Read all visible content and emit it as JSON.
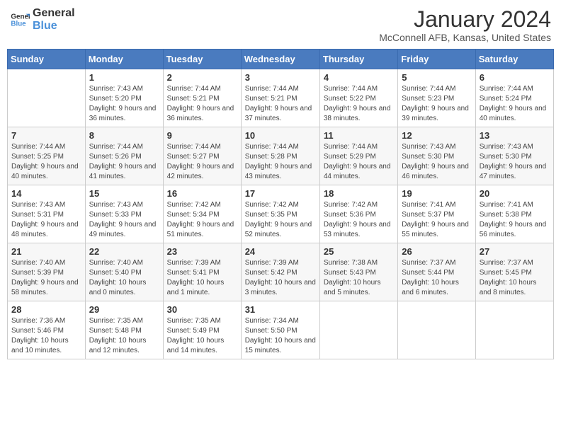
{
  "header": {
    "logo_general": "General",
    "logo_blue": "Blue",
    "month_title": "January 2024",
    "location": "McConnell AFB, Kansas, United States"
  },
  "days_of_week": [
    "Sunday",
    "Monday",
    "Tuesday",
    "Wednesday",
    "Thursday",
    "Friday",
    "Saturday"
  ],
  "weeks": [
    [
      {
        "day": "",
        "info": ""
      },
      {
        "day": "1",
        "info": "Sunrise: 7:43 AM\nSunset: 5:20 PM\nDaylight: 9 hours and 36 minutes."
      },
      {
        "day": "2",
        "info": "Sunrise: 7:44 AM\nSunset: 5:21 PM\nDaylight: 9 hours and 36 minutes."
      },
      {
        "day": "3",
        "info": "Sunrise: 7:44 AM\nSunset: 5:21 PM\nDaylight: 9 hours and 37 minutes."
      },
      {
        "day": "4",
        "info": "Sunrise: 7:44 AM\nSunset: 5:22 PM\nDaylight: 9 hours and 38 minutes."
      },
      {
        "day": "5",
        "info": "Sunrise: 7:44 AM\nSunset: 5:23 PM\nDaylight: 9 hours and 39 minutes."
      },
      {
        "day": "6",
        "info": "Sunrise: 7:44 AM\nSunset: 5:24 PM\nDaylight: 9 hours and 40 minutes."
      }
    ],
    [
      {
        "day": "7",
        "info": "Sunrise: 7:44 AM\nSunset: 5:25 PM\nDaylight: 9 hours and 40 minutes."
      },
      {
        "day": "8",
        "info": "Sunrise: 7:44 AM\nSunset: 5:26 PM\nDaylight: 9 hours and 41 minutes."
      },
      {
        "day": "9",
        "info": "Sunrise: 7:44 AM\nSunset: 5:27 PM\nDaylight: 9 hours and 42 minutes."
      },
      {
        "day": "10",
        "info": "Sunrise: 7:44 AM\nSunset: 5:28 PM\nDaylight: 9 hours and 43 minutes."
      },
      {
        "day": "11",
        "info": "Sunrise: 7:44 AM\nSunset: 5:29 PM\nDaylight: 9 hours and 44 minutes."
      },
      {
        "day": "12",
        "info": "Sunrise: 7:43 AM\nSunset: 5:30 PM\nDaylight: 9 hours and 46 minutes."
      },
      {
        "day": "13",
        "info": "Sunrise: 7:43 AM\nSunset: 5:30 PM\nDaylight: 9 hours and 47 minutes."
      }
    ],
    [
      {
        "day": "14",
        "info": "Sunrise: 7:43 AM\nSunset: 5:31 PM\nDaylight: 9 hours and 48 minutes."
      },
      {
        "day": "15",
        "info": "Sunrise: 7:43 AM\nSunset: 5:33 PM\nDaylight: 9 hours and 49 minutes."
      },
      {
        "day": "16",
        "info": "Sunrise: 7:42 AM\nSunset: 5:34 PM\nDaylight: 9 hours and 51 minutes."
      },
      {
        "day": "17",
        "info": "Sunrise: 7:42 AM\nSunset: 5:35 PM\nDaylight: 9 hours and 52 minutes."
      },
      {
        "day": "18",
        "info": "Sunrise: 7:42 AM\nSunset: 5:36 PM\nDaylight: 9 hours and 53 minutes."
      },
      {
        "day": "19",
        "info": "Sunrise: 7:41 AM\nSunset: 5:37 PM\nDaylight: 9 hours and 55 minutes."
      },
      {
        "day": "20",
        "info": "Sunrise: 7:41 AM\nSunset: 5:38 PM\nDaylight: 9 hours and 56 minutes."
      }
    ],
    [
      {
        "day": "21",
        "info": "Sunrise: 7:40 AM\nSunset: 5:39 PM\nDaylight: 9 hours and 58 minutes."
      },
      {
        "day": "22",
        "info": "Sunrise: 7:40 AM\nSunset: 5:40 PM\nDaylight: 10 hours and 0 minutes."
      },
      {
        "day": "23",
        "info": "Sunrise: 7:39 AM\nSunset: 5:41 PM\nDaylight: 10 hours and 1 minute."
      },
      {
        "day": "24",
        "info": "Sunrise: 7:39 AM\nSunset: 5:42 PM\nDaylight: 10 hours and 3 minutes."
      },
      {
        "day": "25",
        "info": "Sunrise: 7:38 AM\nSunset: 5:43 PM\nDaylight: 10 hours and 5 minutes."
      },
      {
        "day": "26",
        "info": "Sunrise: 7:37 AM\nSunset: 5:44 PM\nDaylight: 10 hours and 6 minutes."
      },
      {
        "day": "27",
        "info": "Sunrise: 7:37 AM\nSunset: 5:45 PM\nDaylight: 10 hours and 8 minutes."
      }
    ],
    [
      {
        "day": "28",
        "info": "Sunrise: 7:36 AM\nSunset: 5:46 PM\nDaylight: 10 hours and 10 minutes."
      },
      {
        "day": "29",
        "info": "Sunrise: 7:35 AM\nSunset: 5:48 PM\nDaylight: 10 hours and 12 minutes."
      },
      {
        "day": "30",
        "info": "Sunrise: 7:35 AM\nSunset: 5:49 PM\nDaylight: 10 hours and 14 minutes."
      },
      {
        "day": "31",
        "info": "Sunrise: 7:34 AM\nSunset: 5:50 PM\nDaylight: 10 hours and 15 minutes."
      },
      {
        "day": "",
        "info": ""
      },
      {
        "day": "",
        "info": ""
      },
      {
        "day": "",
        "info": ""
      }
    ]
  ]
}
